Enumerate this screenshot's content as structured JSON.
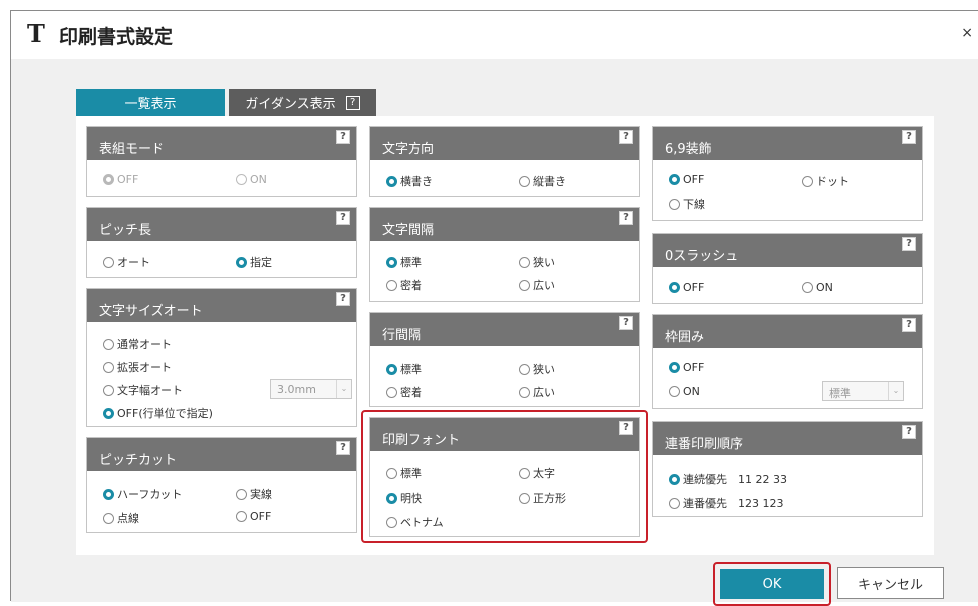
{
  "title": {
    "icon": "T",
    "text": "印刷書式設定",
    "close": "×"
  },
  "tabs": [
    {
      "label": "一覧表示",
      "active": true
    },
    {
      "label": "ガイダンス表示",
      "help": "?",
      "active": false
    }
  ],
  "help_glyph": "?",
  "cards": {
    "table_mode": {
      "title": "表組モード",
      "options": [
        "OFF",
        "ON"
      ]
    },
    "pitch_length": {
      "title": "ピッチ長",
      "options": [
        "オート",
        "指定"
      ]
    },
    "font_size_auto": {
      "title": "文字サイズオート",
      "options": [
        "通常オート",
        "拡張オート",
        "文字幅オート",
        "OFF(行単位で指定)"
      ],
      "combo_value": "3.0mm"
    },
    "pitch_cut": {
      "title": "ピッチカット",
      "options": [
        "ハーフカット",
        "実線",
        "点線",
        "OFF"
      ]
    },
    "text_direction": {
      "title": "文字方向",
      "options": [
        "横書き",
        "縦書き"
      ]
    },
    "char_spacing": {
      "title": "文字間隔",
      "options": [
        "標準",
        "狭い",
        "密着",
        "広い"
      ]
    },
    "line_spacing": {
      "title": "行間隔",
      "options": [
        "標準",
        "狭い",
        "密着",
        "広い"
      ]
    },
    "print_font": {
      "title": "印刷フォント",
      "options": [
        "標準",
        "太字",
        "明快",
        "正方形",
        "ベトナム"
      ]
    },
    "decor69": {
      "title": "6,9装飾",
      "options": [
        "OFF",
        "ドット",
        "下線"
      ]
    },
    "zero_slash": {
      "title": "0スラッシュ",
      "options": [
        "OFF",
        "ON"
      ]
    },
    "frame": {
      "title": "枠囲み",
      "options": [
        "OFF",
        "ON"
      ],
      "combo_value": "標準"
    },
    "serial_order": {
      "title": "連番印刷順序",
      "options": [
        "連続優先",
        "連番優先"
      ],
      "examples": [
        "11 22 33",
        "123 123"
      ]
    }
  },
  "buttons": {
    "ok": "OK",
    "cancel": "キャンセル"
  },
  "colors": {
    "accent": "#1a8ca6",
    "header": "#747474",
    "highlight": "#c8202a"
  }
}
